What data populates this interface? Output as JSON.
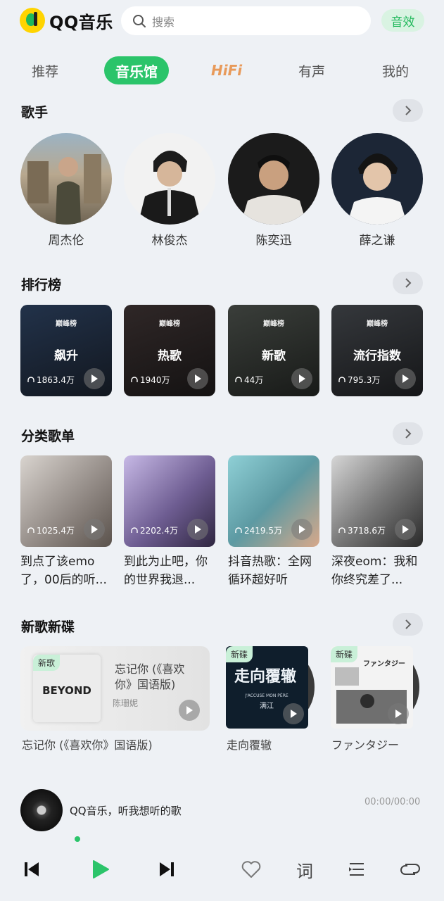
{
  "header": {
    "logo_text": "QQ音乐",
    "search_placeholder": "搜索",
    "effect_label": "音效"
  },
  "tabs": [
    {
      "label": "推荐",
      "active": false
    },
    {
      "label": "音乐馆",
      "active": true
    },
    {
      "label": "HiFi",
      "active": false
    },
    {
      "label": "有声",
      "active": false
    },
    {
      "label": "我的",
      "active": false
    }
  ],
  "sections": {
    "singers": "歌手",
    "ranks": "排行榜",
    "playlists": "分类歌单",
    "new": "新歌新碟"
  },
  "singers": [
    "周杰伦",
    "林俊杰",
    "陈奕迅",
    "薛之谦"
  ],
  "rank_brand": "巅峰榜",
  "ranks": [
    {
      "name": "飙升",
      "count": "1863.4万"
    },
    {
      "name": "热歌",
      "count": "1940万"
    },
    {
      "name": "新歌",
      "count": "44万"
    },
    {
      "name": "流行指数",
      "count": "795.3万"
    }
  ],
  "playlists": [
    {
      "title": "到点了该emo了，00后的听...",
      "count": "1025.4万"
    },
    {
      "title": "到此为止吧，你的世界我退...",
      "count": "2202.4万"
    },
    {
      "title": "抖音热歌：全网循环超好听",
      "count": "2419.5万"
    },
    {
      "title": "深夜eom：我和你终究差了...",
      "count": "3718.6万"
    }
  ],
  "new_releases": {
    "feature": {
      "badge": "新歌",
      "title": "忘记你 (《喜欢你》国语版)",
      "artist": "陈珊妮",
      "caption": "忘记你 (《喜欢你》国语版)",
      "cover_text": "BEYOND"
    },
    "albums": [
      {
        "badge": "新碟",
        "caption": "走向覆辙",
        "cover_text": "走向覆辙",
        "cover_subtext": "J'ACCUSE MON PÈRE",
        "cover_artist": "满江"
      },
      {
        "badge": "新碟",
        "caption": "ファンタジー",
        "cover_text": "ファンタジー"
      }
    ]
  },
  "player": {
    "title": "QQ音乐，听我想听的歌",
    "time": "00:00/00:00",
    "lyric_label": "词"
  },
  "colors": {
    "accent": "#2bc46a",
    "background": "#eef1f5",
    "hifi": "#e89a5a"
  }
}
